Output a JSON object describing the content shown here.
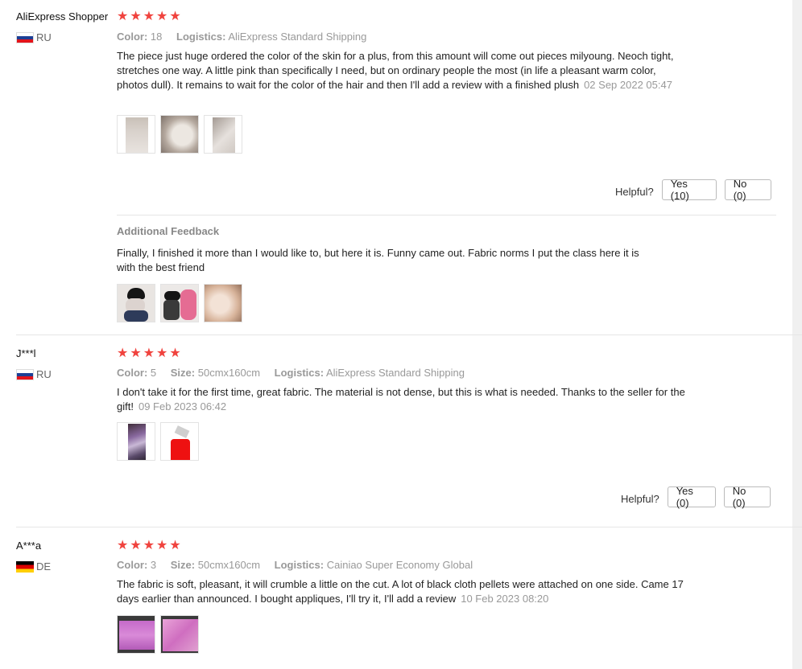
{
  "reviews": [
    {
      "user": "AliExpress Shopper",
      "country": "RU",
      "props": [
        {
          "k": "Color:",
          "v": "18"
        },
        {
          "k": "Logistics:",
          "v": "AliExpress Standard Shipping"
        }
      ],
      "text": "The piece just huge ordered the color of the skin for a plus, from this amount will come out pieces milyoung. Neoch tight, stretches one way. A little pink than specifically I need, but on ordinary people the most (in life a pleasant warm color, photos dull). It remains to wait for the color of the hair and then I'll add a review with a finished plush",
      "date": "02 Sep 2022 05:47",
      "helpful_label": "Helpful?",
      "yes_label": "Yes (10)",
      "no_label": "No (0)",
      "additional": {
        "title": "Additional Feedback",
        "text": "Finally, I finished it more than I would like to, but here it is. Funny came out. Fabric norms I put the class here it is with the best friend"
      }
    },
    {
      "user": "J***l",
      "country": "RU",
      "props": [
        {
          "k": "Color:",
          "v": "5"
        },
        {
          "k": "Size:",
          "v": "50cmx160cm"
        },
        {
          "k": "Logistics:",
          "v": "AliExpress Standard Shipping"
        }
      ],
      "text": "I don't take it for the first time, great fabric. The material is not dense, but this is what is needed. Thanks to the seller for the gift!",
      "date": "09 Feb 2023 06:42",
      "helpful_label": "Helpful?",
      "yes_label": "Yes (0)",
      "no_label": "No (0)"
    },
    {
      "user": "A***a",
      "country": "DE",
      "props": [
        {
          "k": "Color:",
          "v": "3"
        },
        {
          "k": "Size:",
          "v": "50cmx160cm"
        },
        {
          "k": "Logistics:",
          "v": "Cainiao Super Economy Global"
        }
      ],
      "text": "The fabric is soft, pleasant, it will crumble a little on the cut. A lot of black cloth pellets were attached on one side. Came 17 days earlier than announced. I bought appliques, I'll try it, I'll add a review",
      "date": "10 Feb 2023 08:20"
    }
  ],
  "rating_stars": 5,
  "colors": {
    "star": "#f0433e",
    "muted": "#999999",
    "text": "#222222"
  }
}
